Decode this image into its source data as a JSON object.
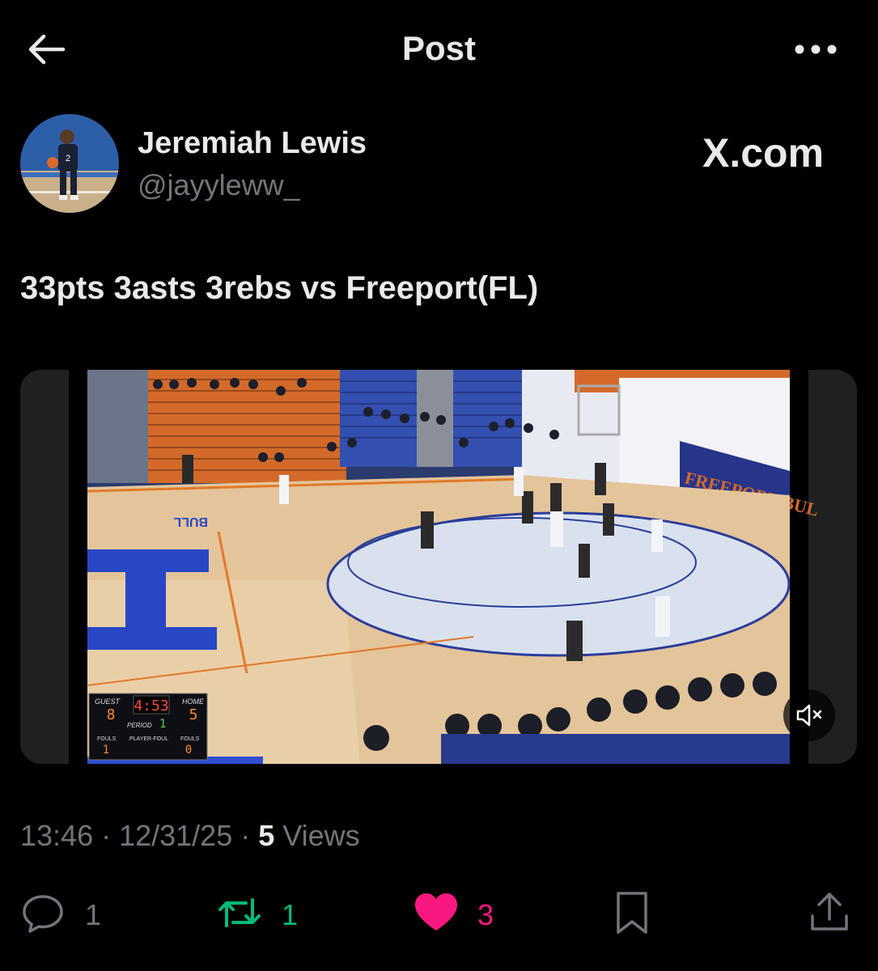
{
  "header": {
    "title": "Post"
  },
  "author": {
    "name": "Jeremiah Lewis",
    "handle": "@jayyleww_"
  },
  "watermark": "X.com",
  "post": {
    "text": "33pts 3asts 3rebs vs Freeport(FL)",
    "time": "13:46",
    "date": "12/31/25",
    "views_count": "5",
    "views_label": "Views"
  },
  "video": {
    "banner_text": "FREEPORT BUL",
    "court_text": "BULL",
    "scoreboard": {
      "guest_label": "GUEST",
      "guest_score": "8",
      "clock": "4:53",
      "home_label": "HOME",
      "home_score": "5",
      "period_label": "PERIOD",
      "period": "1",
      "fouls_label_left": "FOULS",
      "fouls_left": "1",
      "player_foul_label": "PLAYER-FOUL",
      "fouls_label_right": "FOULS",
      "fouls_right": "0"
    }
  },
  "actions": {
    "replies": "1",
    "reposts": "1",
    "likes": "3"
  },
  "colors": {
    "background": "#000000",
    "text": "#e7e9ea",
    "secondary": "#71767b",
    "repost": "#00ba7c",
    "like": "#f91880"
  },
  "icons": [
    "back-arrow-icon",
    "more-icon",
    "mute-icon",
    "reply-icon",
    "repost-icon",
    "heart-icon",
    "bookmark-icon",
    "share-icon"
  ]
}
